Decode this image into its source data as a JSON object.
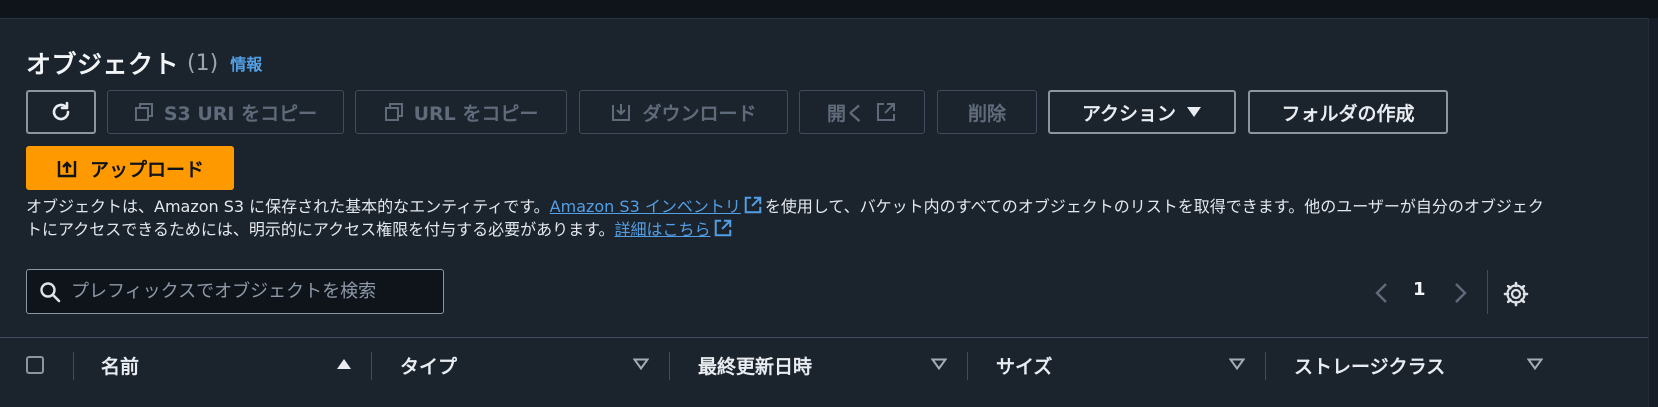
{
  "header": {
    "title": "オブジェクト",
    "count": "(1)",
    "info_link": "情報"
  },
  "toolbar": {
    "refresh_icon": "refresh-icon",
    "copy_s3_uri": "S3 URI をコピー",
    "copy_url": "URL をコピー",
    "download": "ダウンロード",
    "open": "開く",
    "delete": "削除",
    "actions": "アクション",
    "create_folder": "フォルダの作成",
    "upload": "アップロード"
  },
  "description": {
    "text_1": "オブジェクトは、Amazon S3 に保存された基本的なエンティティです。",
    "link_1": "Amazon S3 インベントリ",
    "text_2": "を使用して、バケット内のすべてのオブジェクトのリストを取得できます。他のユーザーが自分のオブジェクトにアクセスできるためには、明示的にアクセス権限を付与する必要があります。",
    "link_2": "詳細はこちら"
  },
  "search": {
    "placeholder": "プレフィックスでオブジェクトを検索",
    "value": ""
  },
  "pagination": {
    "current_page": "1"
  },
  "table": {
    "columns": [
      "名前",
      "タイプ",
      "最終更新日時",
      "サイズ",
      "ストレージクラス"
    ]
  },
  "colors": {
    "background": "#1b232d",
    "accent_orange": "#ff9900",
    "link_blue": "#539fe5",
    "disabled": "#5f6b7a"
  }
}
